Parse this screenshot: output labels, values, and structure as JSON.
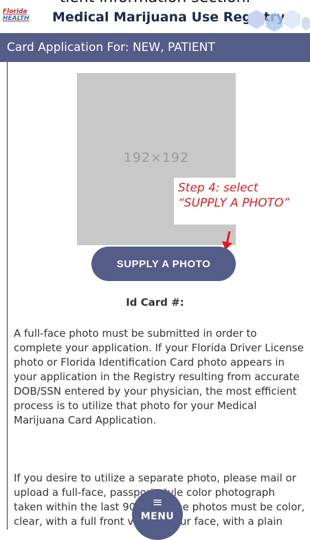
{
  "clipped_text": "tient information section.",
  "topbar": {
    "logo_line1": "Florida",
    "logo_line2": "HEALTH",
    "title": "Medical Marijuana Use Registry"
  },
  "header": {
    "title": "Card Application For: NEW, PATIENT"
  },
  "photo": {
    "placeholder": "192×192"
  },
  "callout": {
    "line1": "Step 4: select",
    "line2": "“SUPPLY A PHOTO”"
  },
  "buttons": {
    "supply_photo": "SUPPLY A PHOTO",
    "menu": "MENU"
  },
  "id_card_label": "Id Card #:",
  "paragraphs": {
    "p1": "A full-face photo must be submitted in order to complete your application. If your Florida Driver License photo or Florida Identification Card photo appears in your application in the Registry resulting from accurate DOB/SSN entered by your physician, the most efficient process is to utilize that photo for your Medical Marijuana Card Application.",
    "p2": "If you desire to utilize a separate photo, please mail or upload a full-face, passport-style color photograph taken within the last 90 days. The photos must be color, clear, with a full front view of your face, with a plain"
  },
  "colors": {
    "brand": "#545c88",
    "callout": "#e11b1b"
  }
}
